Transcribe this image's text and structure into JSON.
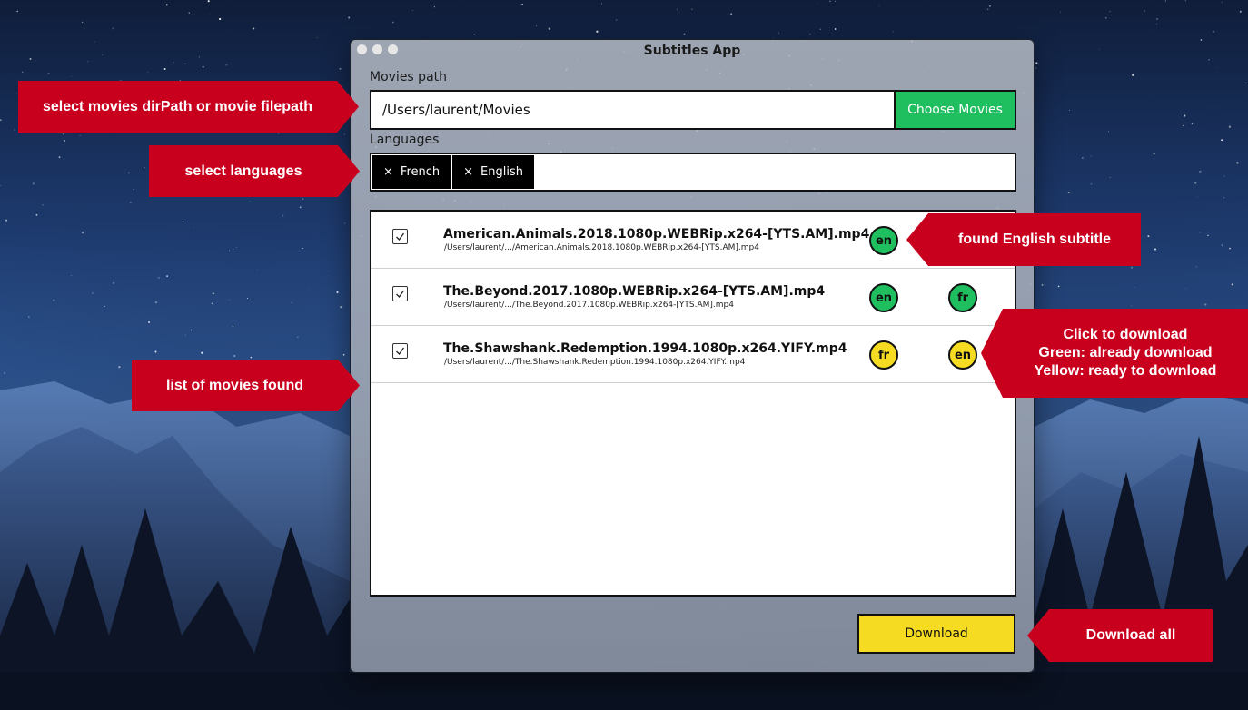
{
  "window": {
    "title": "Subtitles App"
  },
  "movies_path": {
    "label": "Movies path",
    "value": "/Users/laurent/Movies",
    "choose_button": "Choose Movies"
  },
  "languages": {
    "label": "Languages",
    "chips": [
      {
        "remove": "×",
        "label": "French"
      },
      {
        "remove": "×",
        "label": "English"
      }
    ]
  },
  "movies": [
    {
      "checked": true,
      "title": "American.Animals.2018.1080p.WEBRip.x264-[YTS.AM].mp4",
      "path": "/Users/laurent/.../American.Animals.2018.1080p.WEBRip.x264-[YTS.AM].mp4",
      "subtitles": [
        {
          "lang": "en",
          "status": "downloaded",
          "color": "#1fbf5f"
        }
      ]
    },
    {
      "checked": true,
      "title": "The.Beyond.2017.1080p.WEBRip.x264-[YTS.AM].mp4",
      "path": "/Users/laurent/.../The.Beyond.2017.1080p.WEBRip.x264-[YTS.AM].mp4",
      "subtitles": [
        {
          "lang": "en",
          "status": "downloaded",
          "color": "#1fbf5f"
        },
        {
          "lang": "fr",
          "status": "downloaded",
          "color": "#1fbf5f"
        }
      ]
    },
    {
      "checked": true,
      "title": "The.Shawshank.Redemption.1994.1080p.x264.YIFY.mp4",
      "path": "/Users/laurent/.../The.Shawshank.Redemption.1994.1080p.x264.YIFY.mp4",
      "subtitles": [
        {
          "lang": "fr",
          "status": "ready",
          "color": "#f5dc22"
        },
        {
          "lang": "en",
          "status": "ready",
          "color": "#f5dc22"
        }
      ]
    }
  ],
  "download_button": "Download",
  "annotations": {
    "movies_path": "select movies dirPath or movie filepath",
    "languages": "select languages",
    "found_subtitle": "found English subtitle",
    "click_download": [
      "Click to download",
      "Green: already download",
      "Yellow: ready to download"
    ],
    "movie_list": "list of movies found",
    "download_all": "Download all"
  },
  "colors": {
    "annotation": "#c8001e",
    "green": "#1fbf5f",
    "yellow": "#f5dc22"
  }
}
